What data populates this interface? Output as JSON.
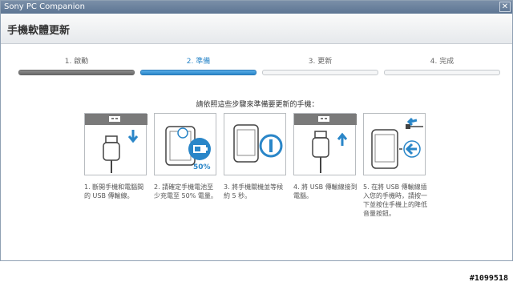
{
  "window": {
    "title": "Sony PC Companion"
  },
  "header": {
    "title": "手機軟體更新"
  },
  "steps": [
    {
      "label": "1. 啟動",
      "state": "done"
    },
    {
      "label": "2. 準備",
      "state": "active"
    },
    {
      "label": "3. 更新",
      "state": "pending"
    },
    {
      "label": "4. 完成",
      "state": "pending"
    }
  ],
  "instruction": "請依照這些步驟來準備要更新的手機：",
  "cards": [
    {
      "icon": "usb-unplug-icon",
      "caption": "1. 斷開手機和電腦間的 USB 傳輸線。"
    },
    {
      "icon": "phone-battery-icon",
      "caption": "2. 請確定手機電池至少充電至 50% 電量。",
      "battery_label": "50%"
    },
    {
      "icon": "phone-power-icon",
      "caption": "3. 將手機關機並等候約 5 秒。"
    },
    {
      "icon": "usb-plug-icon",
      "caption": "4. 將 USB 傳輸線接到電腦。"
    },
    {
      "icon": "phone-usb-connect-icon",
      "caption": "5. 在將 USB 傳輸線插入您的手機時，請按一下並按住手機上的降低音量按鈕。"
    }
  ],
  "watermark": "#1099518",
  "colors": {
    "accent": "#2a86c8",
    "done": "#7a7a7a"
  }
}
